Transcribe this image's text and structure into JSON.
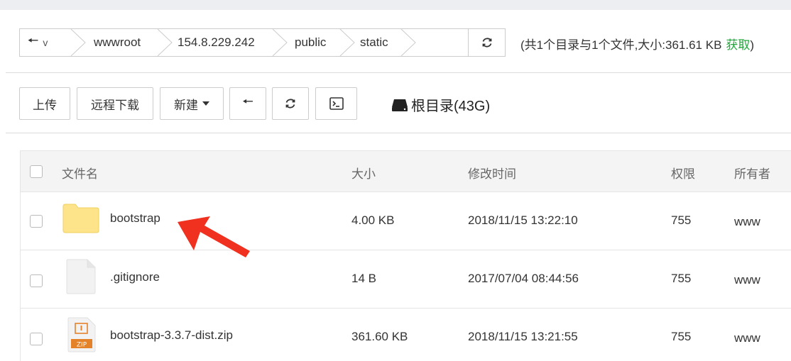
{
  "breadcrumb": {
    "partial": "v",
    "segments": [
      "wwwroot",
      "154.8.229.242",
      "public",
      "static"
    ]
  },
  "summary": {
    "text": "(共1个目录与1个文件,大小:361.61 KB",
    "get_label": "获取",
    "close": ")"
  },
  "toolbar": {
    "upload": "上传",
    "remote_download": "远程下载",
    "new": "新建",
    "disk_label": "根目录(43G)"
  },
  "table": {
    "headers": {
      "name": "文件名",
      "size": "大小",
      "mtime": "修改时间",
      "perm": "权限",
      "owner": "所有者"
    },
    "rows": [
      {
        "type": "folder",
        "name": "bootstrap",
        "size": "4.00 KB",
        "mtime": "2018/11/15 13:22:10",
        "perm": "755",
        "owner": "www"
      },
      {
        "type": "file",
        "name": ".gitignore",
        "size": "14 B",
        "mtime": "2017/07/04 08:44:56",
        "perm": "755",
        "owner": "www"
      },
      {
        "type": "zip",
        "name": "bootstrap-3.3.7-dist.zip",
        "size": "361.60 KB",
        "mtime": "2018/11/15 13:21:55",
        "perm": "755",
        "owner": "www",
        "icon_text": "ZIP"
      }
    ]
  },
  "colors": {
    "accent_green": "#20a53a",
    "annotation_arrow": "#f0311f",
    "folder": "#fde48a"
  }
}
